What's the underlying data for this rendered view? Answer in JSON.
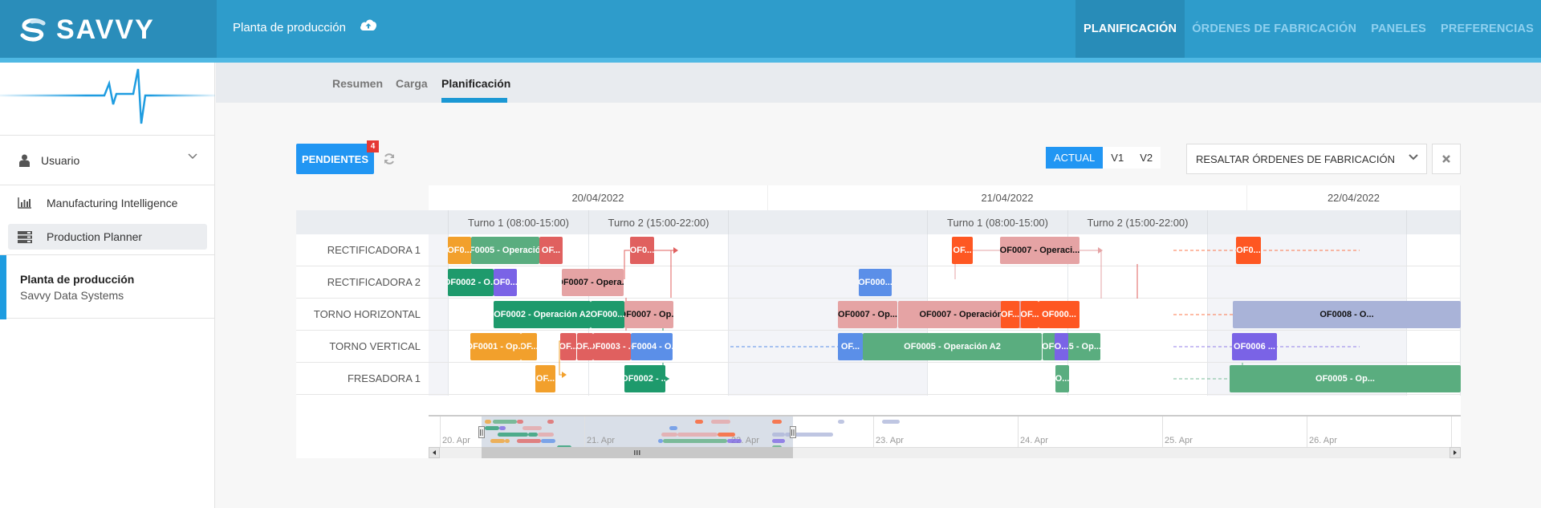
{
  "header": {
    "brand": "SAVVY",
    "plant": "Planta de producción",
    "nav": [
      "PLANIFICACIÓN",
      "ÓRDENES DE FABRICACIÓN",
      "PANELES",
      "PREFERENCIAS"
    ],
    "active_nav": "PLANIFICACIÓN"
  },
  "sidebar": {
    "user": "Usuario",
    "items": [
      {
        "label": "Manufacturing Intelligence",
        "icon": "bar-chart-icon"
      },
      {
        "label": "Production Planner",
        "icon": "server-icon",
        "active": true
      }
    ],
    "plant_title": "Planta de producción",
    "plant_company": "Savvy Data Systems"
  },
  "subnav": {
    "tabs": [
      "Resumen",
      "Carga",
      "Planificación"
    ],
    "active": "Planificación"
  },
  "toolbar": {
    "pending_label": "PENDIENTES",
    "pending_count": "4",
    "versions": [
      "ACTUAL",
      "V1",
      "V2"
    ],
    "active_version": "ACTUAL",
    "highlight_placeholder": "RESALTAR ÓRDENES DE FABRICACIÓN",
    "clear_icon": "close-icon"
  },
  "gantt": {
    "days": [
      "20/04/2022",
      "21/04/2022",
      "22/04/2022"
    ],
    "shifts": [
      "Turno 1 (08:00-15:00)",
      "Turno 2 (15:00-22:00)",
      "Turno 1 (08:00-15:00)",
      "Turno 2 (15:00-22:00)"
    ],
    "resources": [
      "RECTIFICADORA 1",
      "RECTIFICADORA 2",
      "TORNO HORIZONTAL",
      "TORNO VERTICAL",
      "FRESADORA 1"
    ],
    "colors": {
      "orange": "#f2a02c",
      "green": "#5aad7f",
      "darkgreen": "#1e9a6c",
      "red": "#e0605f",
      "pink": "#e5a3a4",
      "purple": "#7a63e6",
      "blue": "#5b8fe8",
      "vermilion": "#fe5722",
      "lavender": "#a9b3d8"
    },
    "tasks": [
      {
        "row": 0,
        "label": "OF0...",
        "color": "orange"
      },
      {
        "row": 0,
        "label": "OF0005 - Operació...",
        "color": "green"
      },
      {
        "row": 0,
        "label": "OF...",
        "color": "red"
      },
      {
        "row": 0,
        "label": "OF0...",
        "color": "red"
      },
      {
        "row": 0,
        "label": "OF...",
        "color": "vermilion"
      },
      {
        "row": 0,
        "label": "OF0007 - Operaci...",
        "color": "pink",
        "dark": true
      },
      {
        "row": 0,
        "label": "OF0...",
        "color": "vermilion"
      },
      {
        "row": 1,
        "label": "OF0002 - O...",
        "color": "darkgreen"
      },
      {
        "row": 1,
        "label": "OF0...",
        "color": "purple"
      },
      {
        "row": 1,
        "label": "OF0007 - Opera...",
        "color": "pink",
        "dark": true
      },
      {
        "row": 1,
        "label": "OF000...",
        "color": "blue"
      },
      {
        "row": 2,
        "label": "OF0002 - Operación A2",
        "color": "darkgreen"
      },
      {
        "row": 2,
        "label": "OF000...",
        "color": "darkgreen"
      },
      {
        "row": 2,
        "label": "OF0007 - Op...",
        "color": "pink",
        "dark": true
      },
      {
        "row": 2,
        "label": "OF0007 - Op...",
        "color": "pink",
        "dark": true
      },
      {
        "row": 2,
        "label": "OF0007 - Operación C4",
        "color": "pink",
        "dark": true
      },
      {
        "row": 2,
        "label": "OF...",
        "color": "vermilion"
      },
      {
        "row": 2,
        "label": "OF...",
        "color": "vermilion"
      },
      {
        "row": 2,
        "label": "OF000...",
        "color": "vermilion"
      },
      {
        "row": 2,
        "label": "OF0008 - O...",
        "color": "lavender",
        "dark": true
      },
      {
        "row": 3,
        "label": "OF0001 - Op...",
        "color": "orange"
      },
      {
        "row": 3,
        "label": "OF...",
        "color": "orange"
      },
      {
        "row": 3,
        "label": "OF...",
        "color": "red"
      },
      {
        "row": 3,
        "label": "OF...",
        "color": "red"
      },
      {
        "row": 3,
        "label": "OF0003 - ...",
        "color": "red"
      },
      {
        "row": 3,
        "label": "OF0004 - O...",
        "color": "blue"
      },
      {
        "row": 3,
        "label": "OF...",
        "color": "blue"
      },
      {
        "row": 3,
        "label": "OF0005 - Operación A2",
        "color": "green"
      },
      {
        "row": 3,
        "label": "OF0005 - Op...",
        "color": "green"
      },
      {
        "row": 3,
        "label": "O...",
        "color": "purple"
      },
      {
        "row": 3,
        "label": "OF0006 ...",
        "color": "purple"
      },
      {
        "row": 4,
        "label": "OF...",
        "color": "orange"
      },
      {
        "row": 4,
        "label": "OF0002 - ...",
        "color": "darkgreen"
      },
      {
        "row": 4,
        "label": "O...",
        "color": "green"
      },
      {
        "row": 4,
        "label": "OF0005 - Op...",
        "color": "green"
      }
    ]
  },
  "navigator": {
    "labels": [
      "20. Apr",
      "21. Apr",
      "22. Apr",
      "23. Apr",
      "24. Apr",
      "25. Apr",
      "26. Apr"
    ]
  }
}
